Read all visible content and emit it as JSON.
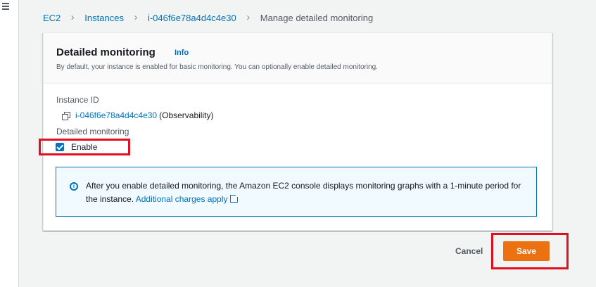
{
  "breadcrumb": {
    "items": [
      "EC2",
      "Instances",
      "i-046f6e78a4d4c4e30"
    ],
    "current": "Manage detailed monitoring"
  },
  "panel": {
    "title": "Detailed monitoring",
    "info_link": "Info",
    "description": "By default, your instance is enabled for basic monitoring. You can optionally enable detailed monitoring."
  },
  "instance": {
    "label": "Instance ID",
    "id": "i-046f6e78a4d4c4e30",
    "name_suffix": "(Observability)"
  },
  "monitoring": {
    "label": "Detailed monitoring",
    "checkbox_label": "Enable",
    "checked": true
  },
  "alert": {
    "text": "After you enable detailed monitoring, the Amazon EC2 console displays monitoring graphs with a 1-minute period for the instance.",
    "link": "Additional charges apply"
  },
  "actions": {
    "cancel": "Cancel",
    "save": "Save"
  },
  "colors": {
    "link": "#0073bb",
    "primary": "#ec7211",
    "highlight": "#e01020"
  }
}
